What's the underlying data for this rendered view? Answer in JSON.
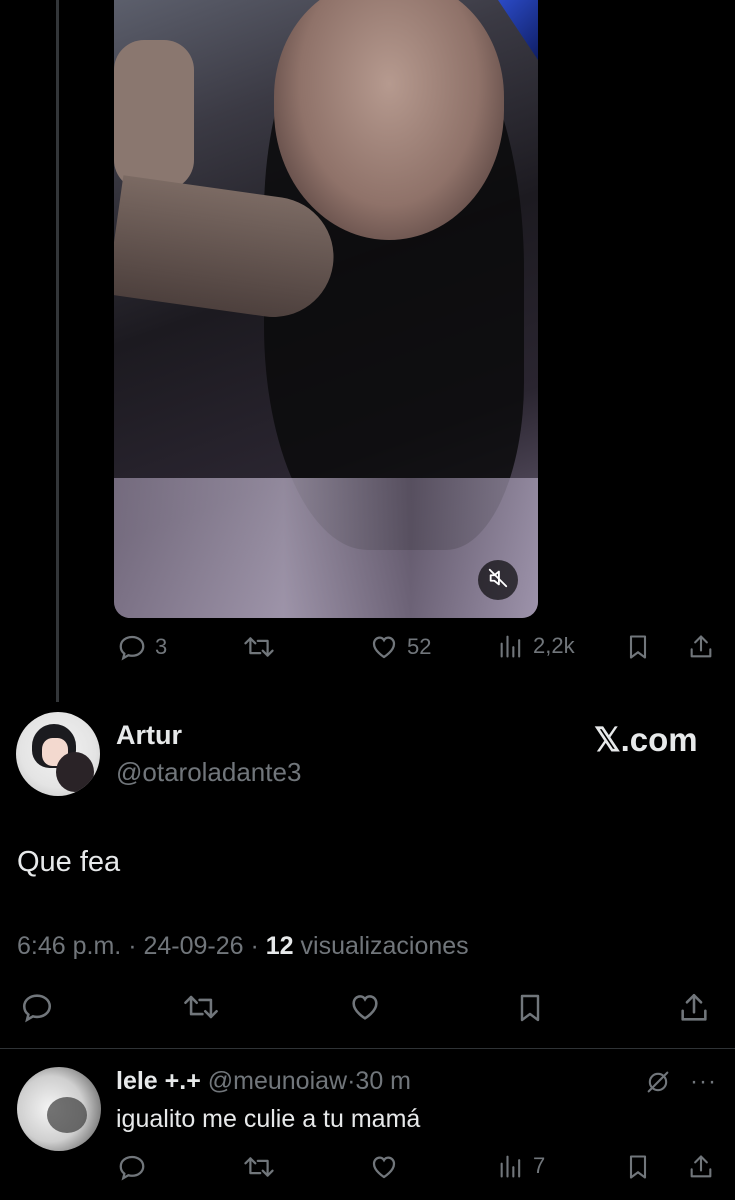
{
  "parent_post": {
    "reply_count": "3",
    "like_count": "52",
    "view_count": "2,2k",
    "icons": {
      "reply": "reply-icon",
      "repost": "repost-icon",
      "like": "like-icon",
      "views": "views-icon",
      "bookmark": "bookmark-icon",
      "share": "share-icon",
      "mute": "mute-icon"
    }
  },
  "focused_post": {
    "author_name": "Artur",
    "author_handle": "@otaroladante3",
    "brand": "𝕏.com",
    "text": "Que fea",
    "time": "6:46 p.m.",
    "separator": "·",
    "date": "24-09-26",
    "views_count": "12",
    "views_label": "visualizaciones"
  },
  "reply": {
    "author_name": "lele +.+",
    "author_handle": "@meunoiaw",
    "separator": "·",
    "age": "30 m",
    "text": "igualito me culie a tu mamá",
    "view_count": "7",
    "more": "···"
  },
  "colors": {
    "background": "#000000",
    "text_primary": "#e7e9ea",
    "text_secondary": "#71767b",
    "divider": "#2f3336"
  }
}
